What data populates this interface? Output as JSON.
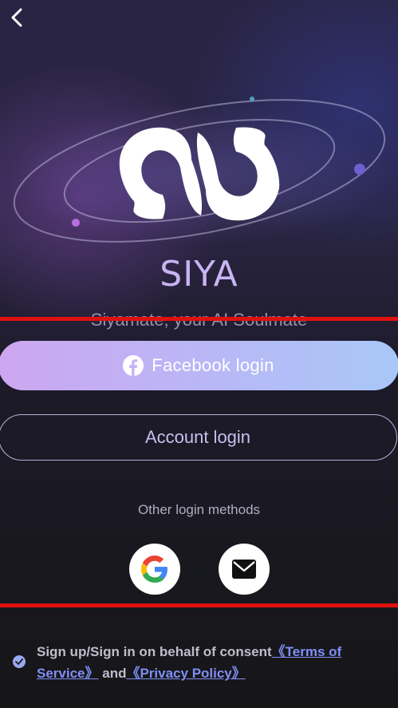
{
  "header": {
    "back_icon": "chevron-left-icon"
  },
  "brand": {
    "name": "SIYA",
    "tagline": "Siyamate, your AI Soulmate",
    "logo": "siya-faces-logo"
  },
  "login": {
    "facebook_label": "Facebook login",
    "facebook_icon": "facebook-icon",
    "account_label": "Account login",
    "other_methods_label": "Other login methods",
    "google_icon": "google-icon",
    "email_icon": "envelope-icon"
  },
  "consent": {
    "prefix": "Sign up/Sign in on behalf of consent",
    "terms_link": "《Terms of Service》",
    "and_text": "and",
    "privacy_link": "《Privacy Policy》",
    "check_icon": "check-icon"
  },
  "colors": {
    "brand": "#c8b4f2",
    "link": "#7f8ff5",
    "annotation_red": "#e01010"
  }
}
